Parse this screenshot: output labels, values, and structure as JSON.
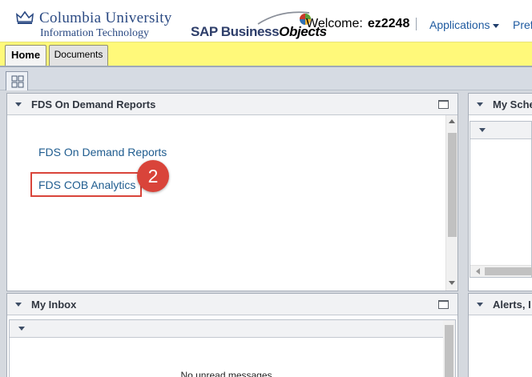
{
  "header": {
    "university_name": "Columbia University",
    "department": "Information Technology",
    "product_logo_sap": "SAP Business",
    "product_logo_objects": "Objects",
    "welcome_label": "Welcome:",
    "username": "ez2248",
    "applications_menu": "Applications",
    "preferences_menu": "Pref"
  },
  "tabs": [
    {
      "label": "Home",
      "active": true
    },
    {
      "label": "Documents",
      "active": false
    }
  ],
  "panes": {
    "fds": {
      "title": "FDS On Demand Reports",
      "links": [
        "FDS On Demand Reports",
        "FDS COB Analytics"
      ],
      "step_badge": "2"
    },
    "schedules": {
      "title": "My Sche"
    },
    "inbox": {
      "title": "My Inbox",
      "empty_text": "No unread messages"
    },
    "alerts": {
      "title": "Alerts, I"
    }
  },
  "colors": {
    "brand_blue": "#2b4a83",
    "tabbar_yellow": "#fff97a",
    "link_blue": "#1f5c8f",
    "annotation_red": "#d9443a"
  }
}
